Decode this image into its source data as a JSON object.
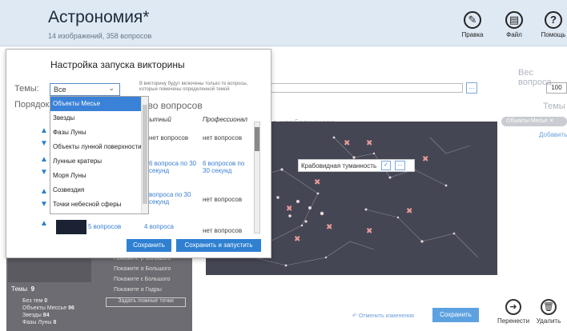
{
  "app": {
    "title": "Астрономия*",
    "subtitle": "14 изображений, 358 вопросов"
  },
  "toolbar": {
    "edit": "Правка",
    "file": "Файл",
    "help": "Помощь"
  },
  "right_panel": {
    "weight_label": "Вес вопроса",
    "weight_value": "100",
    "themes_label": "Темы",
    "theme_chip": "Объекты Месье",
    "add_link": "Добавить"
  },
  "editor": {
    "image_label": "а изображении",
    "search_placeholder": "",
    "browse": "..."
  },
  "tooltip": {
    "text": "Крабовидная туманность"
  },
  "left_list": {
    "items": [
      "Покажите β Большого",
      "Покажите α Большого",
      "Покажите ε Большого",
      "Покажите α Гидры",
      "Задать ложные точки"
    ],
    "themes_title": "Темы",
    "themes_count": "9",
    "themes": [
      {
        "name": "Без тем",
        "count": "0"
      },
      {
        "name": "Объекты Мессье",
        "count": "96"
      },
      {
        "name": "Звезды",
        "count": "84"
      },
      {
        "name": "Фазы Луны",
        "count": "8"
      }
    ]
  },
  "footer": {
    "undo": "Отменить изменения",
    "save": "Сохранить",
    "move": "Перенести",
    "delete": "Удалить"
  },
  "dialog": {
    "title": "Настройка запуска викторины",
    "themes_label": "Темы:",
    "themes_value": "Все",
    "note": "В викторину будут включены только те вопросы, которые помечены определенной темой",
    "order_label": "Порядок",
    "count_label": "ство вопросов",
    "col_a": "мытный",
    "col_b": "Профессионал",
    "rows": [
      {
        "a": "нет вопросов",
        "b": "нет вопросов",
        "a_blue": false,
        "b_blue": false
      },
      {
        "a": "6 вопроса по 30 секунд",
        "b": "6 вопросов по 30 секунд",
        "a_blue": true,
        "b_blue": true
      },
      {
        "a": "вопроса по 30 секунд",
        "b": "нет вопросов",
        "a_blue": true,
        "b_blue": false
      },
      {
        "a": "5 вопросов",
        "b": "4 вопроса",
        "c": "нет вопросов"
      }
    ],
    "save": "Сохранить",
    "save_run": "Сохранить и запустить",
    "dropdown": [
      "Объекты Месье",
      "Звезды",
      "Фазы Луны",
      "Объекты лунной поверхности",
      "Лунные кратеры",
      "Моря Луны",
      "Созвездия",
      "Точки небесной сферы"
    ]
  }
}
